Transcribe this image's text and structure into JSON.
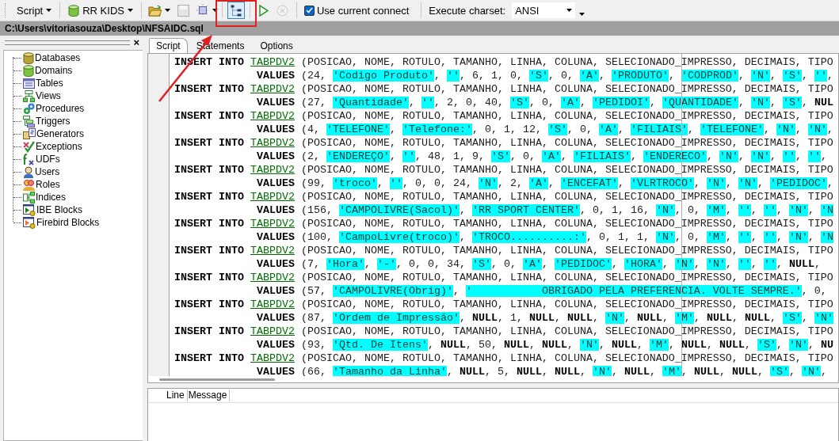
{
  "toolbar": {
    "script_menu": "Script",
    "connection_menu": "RR KIDS",
    "tree_toggle": {
      "pressed": true
    },
    "save": {
      "disabled": true
    },
    "stop": {
      "disabled": true
    },
    "use_current_connect": {
      "label": "Use current connect",
      "checked": true
    },
    "charset": {
      "label": "Execute charset:",
      "value": "ANSI"
    }
  },
  "path_bar": "C:\\Users\\vitoriasouza\\Desktop\\NFSAIDC.sql",
  "sidebar": {
    "close": "×",
    "items": [
      {
        "label": "Databases"
      },
      {
        "label": "Domains"
      },
      {
        "label": "Tables"
      },
      {
        "label": "Views"
      },
      {
        "label": "Procedures"
      },
      {
        "label": "Triggers"
      },
      {
        "label": "Generators"
      },
      {
        "label": "Exceptions"
      },
      {
        "label": "UDFs"
      },
      {
        "label": "Users"
      },
      {
        "label": "Roles"
      },
      {
        "label": "Indices"
      },
      {
        "label": "IBE Blocks"
      },
      {
        "label": "Firebird Blocks"
      }
    ]
  },
  "tabs": [
    {
      "label": "Script",
      "selected": true
    },
    {
      "label": "Statements",
      "selected": false
    },
    {
      "label": "Options",
      "selected": false
    }
  ],
  "editor": {
    "lines": [
      {
        "kind": "insert",
        "tokens": [
          {
            "kind": "keyword",
            "text": "INSERT INTO"
          },
          {
            "kind": "table",
            "text": "TABPDV2"
          },
          {
            "kind": "plain",
            "text": " (POSICAO, NOME, ROTULO, TAMANHO, LINHA, COLUNA, SELECIONADO_IMPRESSO, DECIMAIS, TIPO"
          }
        ]
      },
      {
        "kind": "values",
        "tokens": [
          {
            "kind": "keyword",
            "text": "VALUES"
          },
          {
            "kind": "plain",
            "text": " (24, "
          },
          {
            "kind": "string",
            "text": "'Codigo Produto'"
          },
          {
            "kind": "plain",
            "text": ", "
          },
          {
            "kind": "string",
            "text": "''"
          },
          {
            "kind": "plain",
            "text": ", 6, 1, 0, "
          },
          {
            "kind": "string",
            "text": "'S'"
          },
          {
            "kind": "plain",
            "text": ", 0, "
          },
          {
            "kind": "string",
            "text": "'A'"
          },
          {
            "kind": "plain",
            "text": ", "
          },
          {
            "kind": "string",
            "text": "'PRODUTO'"
          },
          {
            "kind": "plain",
            "text": ", "
          },
          {
            "kind": "string",
            "text": "'CODPROD'"
          },
          {
            "kind": "plain",
            "text": ", "
          },
          {
            "kind": "string",
            "text": "'N'"
          },
          {
            "kind": "plain",
            "text": ", "
          },
          {
            "kind": "string",
            "text": "'S'"
          },
          {
            "kind": "plain",
            "text": ", "
          },
          {
            "kind": "string",
            "text": "''"
          },
          {
            "kind": "plain",
            "text": ","
          }
        ]
      },
      {
        "kind": "insert",
        "tokens": [
          {
            "kind": "keyword",
            "text": "INSERT INTO"
          },
          {
            "kind": "table",
            "text": "TABPDV2"
          },
          {
            "kind": "plain",
            "text": " (POSICAO, NOME, ROTULO, TAMANHO, LINHA, COLUNA, SELECIONADO_IMPRESSO, DECIMAIS, TIPO"
          }
        ]
      },
      {
        "kind": "values",
        "tokens": [
          {
            "kind": "keyword",
            "text": "VALUES"
          },
          {
            "kind": "plain",
            "text": " (27, "
          },
          {
            "kind": "string",
            "text": "'Quantidade'"
          },
          {
            "kind": "plain",
            "text": ", "
          },
          {
            "kind": "string",
            "text": "''"
          },
          {
            "kind": "plain",
            "text": ", 2, 0, 40, "
          },
          {
            "kind": "string",
            "text": "'S'"
          },
          {
            "kind": "plain",
            "text": ", 0, "
          },
          {
            "kind": "string",
            "text": "'A'"
          },
          {
            "kind": "plain",
            "text": ", "
          },
          {
            "kind": "string",
            "text": "'PEDIDOI'"
          },
          {
            "kind": "plain",
            "text": ", "
          },
          {
            "kind": "string",
            "text": "'QUANTIDADE'"
          },
          {
            "kind": "plain",
            "text": ", "
          },
          {
            "kind": "string",
            "text": "'N'"
          },
          {
            "kind": "plain",
            "text": ", "
          },
          {
            "kind": "string",
            "text": "'S'"
          },
          {
            "kind": "plain",
            "text": ", "
          },
          {
            "kind": "null",
            "text": "NUL"
          }
        ]
      },
      {
        "kind": "insert",
        "tokens": [
          {
            "kind": "keyword",
            "text": "INSERT INTO"
          },
          {
            "kind": "table",
            "text": "TABPDV2"
          },
          {
            "kind": "plain",
            "text": " (POSICAO, NOME, ROTULO, TAMANHO, LINHA, COLUNA, SELECIONADO_IMPRESSO, DECIMAIS, TIPO"
          }
        ]
      },
      {
        "kind": "values",
        "tokens": [
          {
            "kind": "keyword",
            "text": "VALUES"
          },
          {
            "kind": "plain",
            "text": " (4, "
          },
          {
            "kind": "string",
            "text": "'TELEFONE'"
          },
          {
            "kind": "plain",
            "text": ", "
          },
          {
            "kind": "string",
            "text": "'Telefone:'"
          },
          {
            "kind": "plain",
            "text": ", 0, 1, 12, "
          },
          {
            "kind": "string",
            "text": "'S'"
          },
          {
            "kind": "plain",
            "text": ", 0, "
          },
          {
            "kind": "string",
            "text": "'A'"
          },
          {
            "kind": "plain",
            "text": ", "
          },
          {
            "kind": "string",
            "text": "'FILIAIS'"
          },
          {
            "kind": "plain",
            "text": ", "
          },
          {
            "kind": "string",
            "text": "'TELEFONE'"
          },
          {
            "kind": "plain",
            "text": ", "
          },
          {
            "kind": "string",
            "text": "'N'"
          },
          {
            "kind": "plain",
            "text": ", "
          },
          {
            "kind": "string",
            "text": "'N'"
          },
          {
            "kind": "plain",
            "text": ","
          }
        ]
      },
      {
        "kind": "insert",
        "tokens": [
          {
            "kind": "keyword",
            "text": "INSERT INTO"
          },
          {
            "kind": "table",
            "text": "TABPDV2"
          },
          {
            "kind": "plain",
            "text": " (POSICAO, NOME, ROTULO, TAMANHO, LINHA, COLUNA, SELECIONADO_IMPRESSO, DECIMAIS, TIPO"
          }
        ]
      },
      {
        "kind": "values",
        "tokens": [
          {
            "kind": "keyword",
            "text": "VALUES"
          },
          {
            "kind": "plain",
            "text": " (2, "
          },
          {
            "kind": "string",
            "text": "'ENDEREÇO'"
          },
          {
            "kind": "plain",
            "text": ", "
          },
          {
            "kind": "string",
            "text": "''"
          },
          {
            "kind": "plain",
            "text": ", 48, 1, 9, "
          },
          {
            "kind": "string",
            "text": "'S'"
          },
          {
            "kind": "plain",
            "text": ", 0, "
          },
          {
            "kind": "string",
            "text": "'A'"
          },
          {
            "kind": "plain",
            "text": ", "
          },
          {
            "kind": "string",
            "text": "'FILIAIS'"
          },
          {
            "kind": "plain",
            "text": ", "
          },
          {
            "kind": "string",
            "text": "'ENDERECO'"
          },
          {
            "kind": "plain",
            "text": ", "
          },
          {
            "kind": "string",
            "text": "'N'"
          },
          {
            "kind": "plain",
            "text": ", "
          },
          {
            "kind": "string",
            "text": "'N'"
          },
          {
            "kind": "plain",
            "text": ", "
          },
          {
            "kind": "string",
            "text": "''"
          },
          {
            "kind": "plain",
            "text": ", "
          },
          {
            "kind": "string",
            "text": "''"
          },
          {
            "kind": "plain",
            "text": ","
          }
        ]
      },
      {
        "kind": "insert",
        "tokens": [
          {
            "kind": "keyword",
            "text": "INSERT INTO"
          },
          {
            "kind": "table",
            "text": "TABPDV2"
          },
          {
            "kind": "plain",
            "text": " (POSICAO, NOME, ROTULO, TAMANHO, LINHA, COLUNA, SELECIONADO_IMPRESSO, DECIMAIS, TIPO"
          }
        ]
      },
      {
        "kind": "values",
        "tokens": [
          {
            "kind": "keyword",
            "text": "VALUES"
          },
          {
            "kind": "plain",
            "text": " (99, "
          },
          {
            "kind": "string",
            "text": "'troco'"
          },
          {
            "kind": "plain",
            "text": ", "
          },
          {
            "kind": "string",
            "text": "''"
          },
          {
            "kind": "plain",
            "text": ", 0, 0, 24, "
          },
          {
            "kind": "string",
            "text": "'N'"
          },
          {
            "kind": "plain",
            "text": ", 2, "
          },
          {
            "kind": "string",
            "text": "'A'"
          },
          {
            "kind": "plain",
            "text": ", "
          },
          {
            "kind": "string",
            "text": "'ENCEFAT'"
          },
          {
            "kind": "plain",
            "text": ", "
          },
          {
            "kind": "string",
            "text": "'VLRTROCO'"
          },
          {
            "kind": "plain",
            "text": ", "
          },
          {
            "kind": "string",
            "text": "'N'"
          },
          {
            "kind": "plain",
            "text": ", "
          },
          {
            "kind": "string",
            "text": "'N'"
          },
          {
            "kind": "plain",
            "text": ", "
          },
          {
            "kind": "string",
            "text": "'PEDIDOC'"
          },
          {
            "kind": "plain",
            "text": ","
          }
        ]
      },
      {
        "kind": "insert",
        "tokens": [
          {
            "kind": "keyword",
            "text": "INSERT INTO"
          },
          {
            "kind": "table",
            "text": "TABPDV2"
          },
          {
            "kind": "plain",
            "text": " (POSICAO, NOME, ROTULO, TAMANHO, LINHA, COLUNA, SELECIONADO_IMPRESSO, DECIMAIS, TIPO"
          }
        ]
      },
      {
        "kind": "values",
        "tokens": [
          {
            "kind": "keyword",
            "text": "VALUES"
          },
          {
            "kind": "plain",
            "text": " (156, "
          },
          {
            "kind": "string",
            "text": "'CAMPOLIVRE(Sacol)'"
          },
          {
            "kind": "plain",
            "text": ", "
          },
          {
            "kind": "string",
            "text": "'RR SPORT CENTER'"
          },
          {
            "kind": "plain",
            "text": ", 0, 1, 16, "
          },
          {
            "kind": "string",
            "text": "'N'"
          },
          {
            "kind": "plain",
            "text": ", 0, "
          },
          {
            "kind": "string",
            "text": "'M'"
          },
          {
            "kind": "plain",
            "text": ", "
          },
          {
            "kind": "string",
            "text": "''"
          },
          {
            "kind": "plain",
            "text": ", "
          },
          {
            "kind": "string",
            "text": "''"
          },
          {
            "kind": "plain",
            "text": ", "
          },
          {
            "kind": "string",
            "text": "'N'"
          },
          {
            "kind": "plain",
            "text": ", "
          },
          {
            "kind": "string",
            "text": "'N"
          }
        ]
      },
      {
        "kind": "insert",
        "tokens": [
          {
            "kind": "keyword",
            "text": "INSERT INTO"
          },
          {
            "kind": "table",
            "text": "TABPDV2"
          },
          {
            "kind": "plain",
            "text": " (POSICAO, NOME, ROTULO, TAMANHO, LINHA, COLUNA, SELECIONADO_IMPRESSO, DECIMAIS, TIPO"
          }
        ]
      },
      {
        "kind": "values",
        "tokens": [
          {
            "kind": "keyword",
            "text": "VALUES"
          },
          {
            "kind": "plain",
            "text": " (100, "
          },
          {
            "kind": "string",
            "text": "'CampoLivre(troco)'"
          },
          {
            "kind": "plain",
            "text": ", "
          },
          {
            "kind": "string",
            "text": "'TROCO..........:'"
          },
          {
            "kind": "plain",
            "text": ", 0, 1, 1, "
          },
          {
            "kind": "string",
            "text": "'N'"
          },
          {
            "kind": "plain",
            "text": ", 0, "
          },
          {
            "kind": "string",
            "text": "'M'"
          },
          {
            "kind": "plain",
            "text": ", "
          },
          {
            "kind": "string",
            "text": "''"
          },
          {
            "kind": "plain",
            "text": ", "
          },
          {
            "kind": "string",
            "text": "''"
          },
          {
            "kind": "plain",
            "text": ", "
          },
          {
            "kind": "string",
            "text": "'N'"
          },
          {
            "kind": "plain",
            "text": ", "
          },
          {
            "kind": "string",
            "text": "'N"
          }
        ]
      },
      {
        "kind": "insert",
        "tokens": [
          {
            "kind": "keyword",
            "text": "INSERT INTO"
          },
          {
            "kind": "table",
            "text": "TABPDV2"
          },
          {
            "kind": "plain",
            "text": " (POSICAO, NOME, ROTULO, TAMANHO, LINHA, COLUNA, SELECIONADO_IMPRESSO, DECIMAIS, TIPO"
          }
        ]
      },
      {
        "kind": "values",
        "tokens": [
          {
            "kind": "keyword",
            "text": "VALUES"
          },
          {
            "kind": "plain",
            "text": " (7, "
          },
          {
            "kind": "string",
            "text": "'Hora'"
          },
          {
            "kind": "plain",
            "text": ", "
          },
          {
            "kind": "string",
            "text": "'-'"
          },
          {
            "kind": "plain",
            "text": ", 0, 0, 34, "
          },
          {
            "kind": "string",
            "text": "'S'"
          },
          {
            "kind": "plain",
            "text": ", 0, "
          },
          {
            "kind": "string",
            "text": "'A'"
          },
          {
            "kind": "plain",
            "text": ", "
          },
          {
            "kind": "string",
            "text": "'PEDIDOC'"
          },
          {
            "kind": "plain",
            "text": ", "
          },
          {
            "kind": "string",
            "text": "'HORA'"
          },
          {
            "kind": "plain",
            "text": ", "
          },
          {
            "kind": "string",
            "text": "'N'"
          },
          {
            "kind": "plain",
            "text": ", "
          },
          {
            "kind": "string",
            "text": "'N'"
          },
          {
            "kind": "plain",
            "text": ", "
          },
          {
            "kind": "string",
            "text": "''"
          },
          {
            "kind": "plain",
            "text": ", "
          },
          {
            "kind": "string",
            "text": "''"
          },
          {
            "kind": "plain",
            "text": ", "
          },
          {
            "kind": "null",
            "text": "NULL"
          },
          {
            "kind": "plain",
            "text": ","
          }
        ]
      },
      {
        "kind": "insert",
        "tokens": [
          {
            "kind": "keyword",
            "text": "INSERT INTO"
          },
          {
            "kind": "table",
            "text": "TABPDV2"
          },
          {
            "kind": "plain",
            "text": " (POSICAO, NOME, ROTULO, TAMANHO, LINHA, COLUNA, SELECIONADO_IMPRESSO, DECIMAIS, TIPO"
          }
        ]
      },
      {
        "kind": "values",
        "tokens": [
          {
            "kind": "keyword",
            "text": "VALUES"
          },
          {
            "kind": "plain",
            "text": " (57, "
          },
          {
            "kind": "string",
            "text": "'CAMPOLIVRE(Obrig)'"
          },
          {
            "kind": "plain",
            "text": ", "
          },
          {
            "kind": "string",
            "text": "'           OBRIGADO PELA PREFERENCIA. VOLTE SEMPRE.'"
          },
          {
            "kind": "plain",
            "text": ", 0,"
          }
        ]
      },
      {
        "kind": "insert",
        "tokens": [
          {
            "kind": "keyword",
            "text": "INSERT INTO"
          },
          {
            "kind": "table",
            "text": "TABPDV2"
          },
          {
            "kind": "plain",
            "text": " (POSICAO, NOME, ROTULO, TAMANHO, LINHA, COLUNA, SELECIONADO_IMPRESSO, DECIMAIS, TIPO"
          }
        ]
      },
      {
        "kind": "values",
        "tokens": [
          {
            "kind": "keyword",
            "text": "VALUES"
          },
          {
            "kind": "plain",
            "text": " (87, "
          },
          {
            "kind": "string",
            "text": "'Ordem de Impressão'"
          },
          {
            "kind": "plain",
            "text": ", "
          },
          {
            "kind": "null",
            "text": "NULL"
          },
          {
            "kind": "plain",
            "text": ", 1, "
          },
          {
            "kind": "null",
            "text": "NULL"
          },
          {
            "kind": "plain",
            "text": ", "
          },
          {
            "kind": "null",
            "text": "NULL"
          },
          {
            "kind": "plain",
            "text": ", "
          },
          {
            "kind": "string",
            "text": "'N'"
          },
          {
            "kind": "plain",
            "text": ", "
          },
          {
            "kind": "null",
            "text": "NULL"
          },
          {
            "kind": "plain",
            "text": ", "
          },
          {
            "kind": "string",
            "text": "'M'"
          },
          {
            "kind": "plain",
            "text": ", "
          },
          {
            "kind": "null",
            "text": "NULL"
          },
          {
            "kind": "plain",
            "text": ", "
          },
          {
            "kind": "null",
            "text": "NULL"
          },
          {
            "kind": "plain",
            "text": ", "
          },
          {
            "kind": "string",
            "text": "'S'"
          },
          {
            "kind": "plain",
            "text": ", "
          },
          {
            "kind": "string",
            "text": "'N'"
          }
        ]
      },
      {
        "kind": "insert",
        "tokens": [
          {
            "kind": "keyword",
            "text": "INSERT INTO"
          },
          {
            "kind": "table",
            "text": "TABPDV2"
          },
          {
            "kind": "plain",
            "text": " (POSICAO, NOME, ROTULO, TAMANHO, LINHA, COLUNA, SELECIONADO_IMPRESSO, DECIMAIS, TIPO"
          }
        ]
      },
      {
        "kind": "values",
        "tokens": [
          {
            "kind": "keyword",
            "text": "VALUES"
          },
          {
            "kind": "plain",
            "text": " (93, "
          },
          {
            "kind": "string",
            "text": "'Qtd. De Itens'"
          },
          {
            "kind": "plain",
            "text": ", "
          },
          {
            "kind": "null",
            "text": "NULL"
          },
          {
            "kind": "plain",
            "text": ", 50, "
          },
          {
            "kind": "null",
            "text": "NULL"
          },
          {
            "kind": "plain",
            "text": ", "
          },
          {
            "kind": "null",
            "text": "NULL"
          },
          {
            "kind": "plain",
            "text": ", "
          },
          {
            "kind": "string",
            "text": "'N'"
          },
          {
            "kind": "plain",
            "text": ", "
          },
          {
            "kind": "null",
            "text": "NULL"
          },
          {
            "kind": "plain",
            "text": ", "
          },
          {
            "kind": "string",
            "text": "'M'"
          },
          {
            "kind": "plain",
            "text": ", "
          },
          {
            "kind": "null",
            "text": "NULL"
          },
          {
            "kind": "plain",
            "text": ", "
          },
          {
            "kind": "null",
            "text": "NULL"
          },
          {
            "kind": "plain",
            "text": ", "
          },
          {
            "kind": "string",
            "text": "'S'"
          },
          {
            "kind": "plain",
            "text": ", "
          },
          {
            "kind": "string",
            "text": "'N'"
          },
          {
            "kind": "plain",
            "text": ", "
          },
          {
            "kind": "null",
            "text": "NU"
          }
        ]
      },
      {
        "kind": "insert",
        "tokens": [
          {
            "kind": "keyword",
            "text": "INSERT INTO"
          },
          {
            "kind": "table",
            "text": "TABPDV2"
          },
          {
            "kind": "plain",
            "text": " (POSICAO, NOME, ROTULO, TAMANHO, LINHA, COLUNA, SELECIONADO_IMPRESSO, DECIMAIS, TIPO"
          }
        ]
      },
      {
        "kind": "values",
        "tokens": [
          {
            "kind": "keyword",
            "text": "VALUES"
          },
          {
            "kind": "plain",
            "text": " (66, "
          },
          {
            "kind": "string",
            "text": "'Tamanho da Linha'"
          },
          {
            "kind": "plain",
            "text": ", "
          },
          {
            "kind": "null",
            "text": "NULL"
          },
          {
            "kind": "plain",
            "text": ", 5, "
          },
          {
            "kind": "null",
            "text": "NULL"
          },
          {
            "kind": "plain",
            "text": ", "
          },
          {
            "kind": "null",
            "text": "NULL"
          },
          {
            "kind": "plain",
            "text": ", "
          },
          {
            "kind": "string",
            "text": "'N'"
          },
          {
            "kind": "plain",
            "text": ", "
          },
          {
            "kind": "null",
            "text": "NULL"
          },
          {
            "kind": "plain",
            "text": ", "
          },
          {
            "kind": "string",
            "text": "'M'"
          },
          {
            "kind": "plain",
            "text": ", "
          },
          {
            "kind": "null",
            "text": "NULL"
          },
          {
            "kind": "plain",
            "text": ", "
          },
          {
            "kind": "null",
            "text": "NULL"
          },
          {
            "kind": "plain",
            "text": ", "
          },
          {
            "kind": "string",
            "text": "'S'"
          },
          {
            "kind": "plain",
            "text": ", "
          },
          {
            "kind": "string",
            "text": "'N'"
          },
          {
            "kind": "plain",
            "text": ","
          }
        ]
      }
    ]
  },
  "messages": {
    "columns": [
      "Line",
      "Message"
    ]
  }
}
